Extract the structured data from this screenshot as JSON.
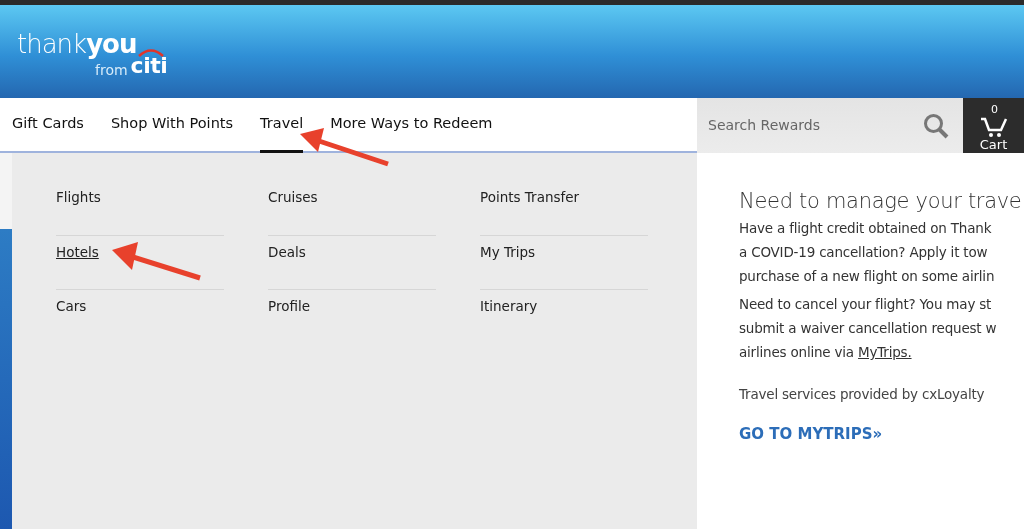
{
  "logo": {
    "brand": "thankyou",
    "sub": "from",
    "mark": "citi"
  },
  "nav": {
    "tabs": [
      {
        "label": "Gift Cards",
        "selected": false
      },
      {
        "label": "Shop With Points",
        "selected": false
      },
      {
        "label": "Travel",
        "selected": true
      },
      {
        "label": "More Ways to Redeem",
        "selected": false
      }
    ],
    "search": {
      "placeholder": "Search Rewards"
    },
    "cart": {
      "count": "0",
      "label": "Cart"
    }
  },
  "travel_menu": {
    "columns": [
      [
        {
          "label": "Flights",
          "selected": false
        },
        {
          "label": "Hotels",
          "selected": true
        },
        {
          "label": "Cars",
          "selected": false
        }
      ],
      [
        {
          "label": "Cruises",
          "selected": false
        },
        {
          "label": "Deals",
          "selected": false
        },
        {
          "label": "Profile",
          "selected": false
        }
      ],
      [
        {
          "label": "Points Transfer",
          "selected": false
        },
        {
          "label": "My Trips",
          "selected": false
        },
        {
          "label": "Itinerary",
          "selected": false
        }
      ]
    ]
  },
  "info_panel": {
    "heading": "Need to manage your trave",
    "paragraphs": [
      {
        "lines": [
          {
            "text": "Have a flight credit obtained on Thank"
          },
          {
            "text": "a COVID-19 cancellation? Apply it tow"
          },
          {
            "text": "purchase of a new flight on some airlin"
          }
        ]
      },
      {
        "lines": [
          {
            "text": "Need to cancel your flight? You may st"
          },
          {
            "text": "submit a waiver cancellation request w"
          },
          {
            "text": "airlines online via ",
            "link": "MyTrips."
          }
        ]
      }
    ],
    "note": "Travel services provided by cxLoyalty",
    "cta": "GO TO MYTRIPS»"
  }
}
